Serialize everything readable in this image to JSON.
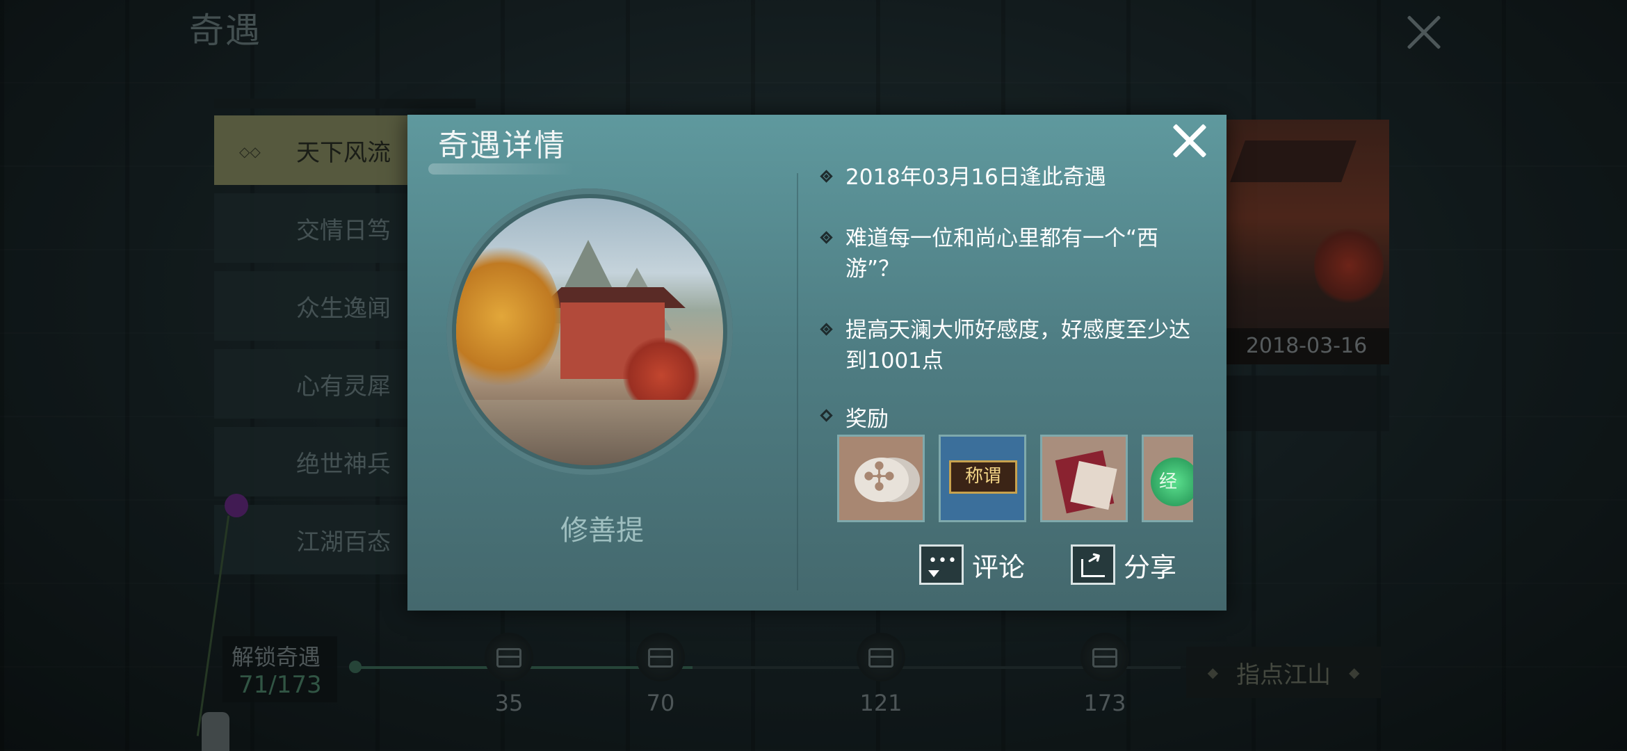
{
  "page": {
    "title": "奇遇"
  },
  "sidebar": {
    "items": [
      {
        "label": "天下风流",
        "active": true
      },
      {
        "label": "交情日笃",
        "active": false
      },
      {
        "label": "众生逸闻",
        "active": false
      },
      {
        "label": "心有灵犀",
        "active": false
      },
      {
        "label": "绝世神兵",
        "active": false
      },
      {
        "label": "江湖百态",
        "active": false
      }
    ]
  },
  "background_card": {
    "date": "2018-03-16"
  },
  "progress": {
    "label": "解锁奇遇",
    "count": "71/173",
    "unlocked": 71,
    "total": 173,
    "milestones": [
      "35",
      "70",
      "121",
      "173"
    ]
  },
  "guide_button": {
    "label": "指点江山"
  },
  "modal": {
    "title": "奇遇详情",
    "portrait_name": "修善提",
    "info": [
      "2018年03月16日逢此奇遇",
      "难道每一位和尚心里都有一个“西游”？",
      "提高天澜大师好感度，好感度至少达到1001点"
    ],
    "reward_label": "奖励",
    "rewards": [
      {
        "icon": "coin-icon"
      },
      {
        "icon": "title-plaque-icon",
        "text": "称谓"
      },
      {
        "icon": "book-icon"
      },
      {
        "icon": "jade-orb-icon",
        "text": "经"
      }
    ],
    "comment_label": "评论",
    "share_label": "分享"
  }
}
